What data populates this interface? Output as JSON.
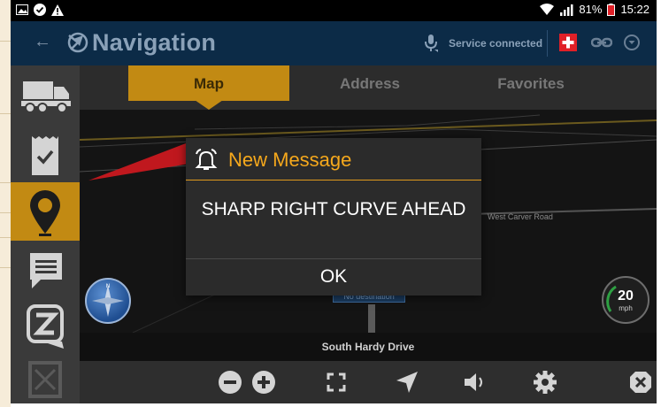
{
  "status_bar": {
    "battery_percent": "81%",
    "time": "15:22",
    "left_icons": [
      "image-icon",
      "check-circle-icon",
      "warning-icon"
    ],
    "right_icons": [
      "wifi-icon",
      "signal-icon",
      "battery-icon"
    ]
  },
  "app_bar": {
    "title": "Navigation",
    "service_status": "Service connected",
    "icons": [
      "back-arrow-icon",
      "navigation-logo-icon",
      "microphone-icon",
      "swiss-flag-icon",
      "link-icon",
      "dropdown-icon"
    ]
  },
  "sidebar": {
    "items": [
      {
        "name": "truck",
        "icon": "truck-icon"
      },
      {
        "name": "receipt",
        "icon": "receipt-check-icon"
      },
      {
        "name": "navigation",
        "icon": "map-pin-icon",
        "active": true
      },
      {
        "name": "messages",
        "icon": "message-icon"
      },
      {
        "name": "z-app",
        "icon": "z-logo-icon"
      },
      {
        "name": "documents",
        "icon": "document-icon"
      }
    ]
  },
  "tabs": [
    {
      "label": "Map",
      "active": true
    },
    {
      "label": "Address",
      "active": false
    },
    {
      "label": "Favorites",
      "active": false
    }
  ],
  "map": {
    "road_label": "West Carver Road",
    "no_destination": "No destination",
    "speed_value": "20",
    "speed_unit": "mph",
    "street_name": "South Hardy Drive"
  },
  "dialog": {
    "title": "New Message",
    "message": "SHARP RIGHT CURVE AHEAD",
    "ok_label": "OK"
  },
  "toolbar": {
    "buttons": [
      "zoom-out-icon",
      "zoom-in-icon",
      "fullscreen-icon",
      "locate-icon",
      "volume-icon",
      "settings-icon",
      "close-icon"
    ]
  },
  "colors": {
    "accent": "#c28a13",
    "appbar_bg": "#0c2b47",
    "dialog_title": "#f5a81c"
  }
}
